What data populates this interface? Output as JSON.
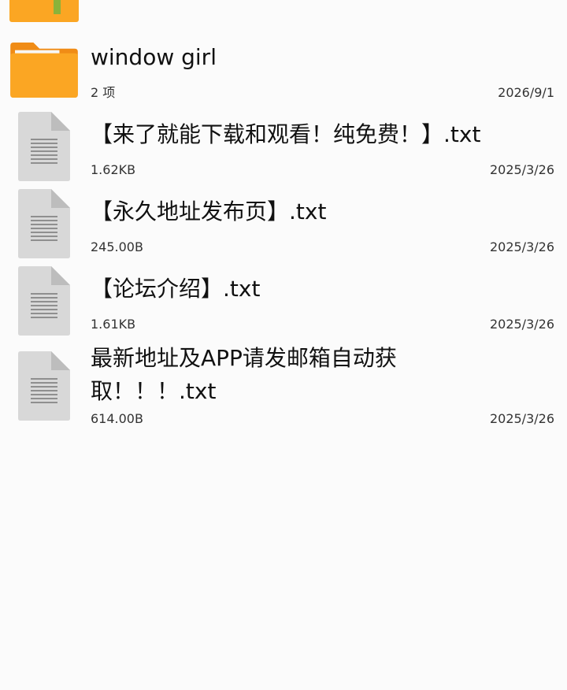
{
  "colors": {
    "folder_orange": "#fba623",
    "folder_orange_dark": "#f08c16",
    "folder_tab": "#f7f7f7",
    "file_bg": "#d8d8d8",
    "file_fold": "#bdbdbd",
    "file_lines": "#8f8f8f",
    "background": "#fbfbfb",
    "partial_folder_bar": "#8ab33a"
  },
  "items": [
    {
      "type": "folder",
      "icon": "folder-icon",
      "name": "window girl",
      "meta": "2 项",
      "date": "2026/9/1"
    },
    {
      "type": "file",
      "icon": "text-file-icon",
      "name": "【来了就能下载和观看！纯免费！】.txt",
      "meta": "1.62KB",
      "date": "2025/3/26"
    },
    {
      "type": "file",
      "icon": "text-file-icon",
      "name": "【永久地址发布页】.txt",
      "meta": "245.00B",
      "date": "2025/3/26"
    },
    {
      "type": "file",
      "icon": "text-file-icon",
      "name": "【论坛介绍】.txt",
      "meta": "1.61KB",
      "date": "2025/3/26"
    },
    {
      "type": "file",
      "icon": "text-file-icon",
      "name": "最新地址及APP请发邮箱自动获取！！！.txt",
      "meta": "614.00B",
      "date": "2025/3/26"
    }
  ]
}
